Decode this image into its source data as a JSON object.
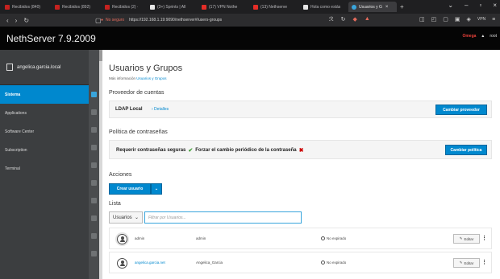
{
  "browser": {
    "tabs": [
      {
        "label": "Recibidos (840)",
        "color": "#c5221f"
      },
      {
        "label": "Recibidos (892)",
        "color": "#c5221f"
      },
      {
        "label": "Recibidos (2) ·",
        "color": "#c5221f"
      },
      {
        "label": "(3+) Sprints | All",
        "color": "#e6e6e6"
      },
      {
        "label": "(17) VPN Nothe",
        "color": "#e52d27"
      },
      {
        "label": "(13) Nethserve",
        "color": "#e52d27"
      },
      {
        "label": "Hola como estás",
        "color": "#e6e6e6"
      },
      {
        "label": "Usuarios y G",
        "color": "#39a5dc"
      }
    ],
    "new_tab": "+",
    "security_label": "No seguro",
    "url": "https://192.168.1.19:9090/nethserver#/users-groups",
    "vpn_label": "VPN"
  },
  "app": {
    "brand": "NethServer 7.9.2009",
    "header_badge": "Omega",
    "user": "root"
  },
  "sidebar": {
    "host": "angelica.garcia.local",
    "items": [
      {
        "label": "Sistema"
      },
      {
        "label": "Applications"
      },
      {
        "label": "Software Center"
      },
      {
        "label": "Subscription"
      },
      {
        "label": "Terminal"
      }
    ]
  },
  "main": {
    "title": "Usuarios y Grupos",
    "more_prefix": "Más información",
    "more_link": "Usuarios y Grupos",
    "accounts_provider": {
      "title": "Proveedor de cuentas",
      "label": "LDAP Local",
      "link": "› Detalles",
      "button": "Cambiar proveedor"
    },
    "password_policy": {
      "title": "Política de contraseñas",
      "strong": "Requerir contraseñas seguras",
      "expire": "Forzar el cambio periódico de la contraseña",
      "button": "Cambiar política"
    },
    "actions": {
      "title": "Acciones",
      "create_button": "Crear usuario"
    },
    "list": {
      "title": "Lista",
      "filter_select": "Usuarios",
      "filter_placeholder": "Filtrar por Usuarios...",
      "rows": [
        {
          "username": "admin",
          "fullname": "admin",
          "status": "No expirado",
          "edit": "Editar"
        },
        {
          "username": "angelica.garcia.net",
          "fullname": "Angelica_Garcia",
          "status": "No expirado",
          "edit": "Editar"
        }
      ]
    }
  }
}
